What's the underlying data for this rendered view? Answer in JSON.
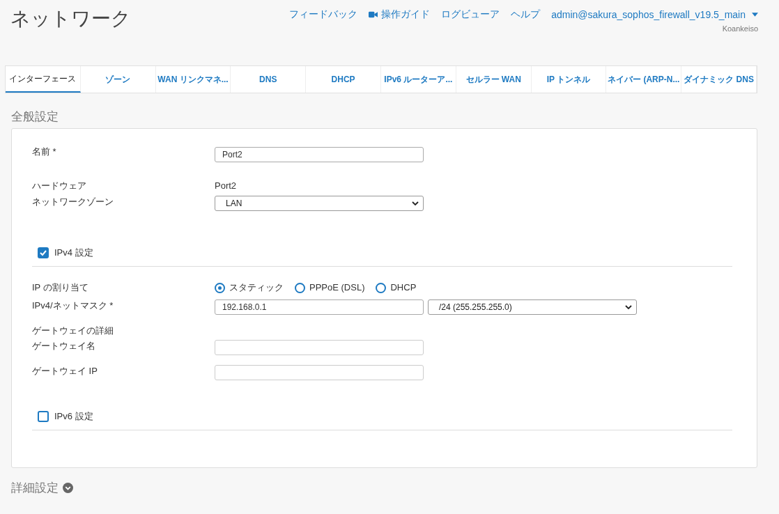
{
  "header": {
    "title": "ネットワーク",
    "links": [
      {
        "label": "フィードバック",
        "kind": "text"
      },
      {
        "label": "操作ガイド",
        "kind": "video"
      },
      {
        "label": "ログビューア",
        "kind": "text"
      },
      {
        "label": "ヘルプ",
        "kind": "text"
      }
    ],
    "user": "admin@sakura_sophos_firewall_v19.5_main",
    "organization": "Koankeiso"
  },
  "tabs": [
    {
      "label": "インターフェース",
      "selected": true
    },
    {
      "label": "ゾーン",
      "selected": false
    },
    {
      "label": "WAN リンクマネ...",
      "selected": false
    },
    {
      "label": "DNS",
      "selected": false
    },
    {
      "label": "DHCP",
      "selected": false
    },
    {
      "label": "IPv6 ルーターア...",
      "selected": false
    },
    {
      "label": "セルラー WAN",
      "selected": false
    },
    {
      "label": "IP トンネル",
      "selected": false
    },
    {
      "label": "ネイバー (ARP-N...",
      "selected": false
    },
    {
      "label": "ダイナミック DNS",
      "selected": false
    }
  ],
  "section_title": "全般設定",
  "form": {
    "name": {
      "label": "名前 *",
      "value": "Port2"
    },
    "hardware": {
      "label": "ハードウェア",
      "value": "Port2"
    },
    "zone": {
      "label": "ネットワークゾーン",
      "value": "LAN"
    },
    "ipv4": {
      "label": "IPv4 設定",
      "checked": true
    },
    "ip_assignment": {
      "label": "IP の割り当て",
      "options": [
        {
          "label": "スタティック",
          "selected": true
        },
        {
          "label": "PPPoE (DSL)",
          "selected": false
        },
        {
          "label": "DHCP",
          "selected": false
        }
      ]
    },
    "ipv4_netmask": {
      "label": "IPv4/ネットマスク *",
      "value": "192.168.0.1",
      "mask": "/24 (255.255.255.0)"
    },
    "gateway_details": {
      "label": "ゲートウェイの詳細"
    },
    "gateway_name": {
      "label": "ゲートウェイ名"
    },
    "gateway_ip": {
      "label": "ゲートウェイ IP"
    },
    "ipv6": {
      "label": "IPv6 設定",
      "checked": false
    }
  },
  "advanced": {
    "label": "詳細設定"
  }
}
